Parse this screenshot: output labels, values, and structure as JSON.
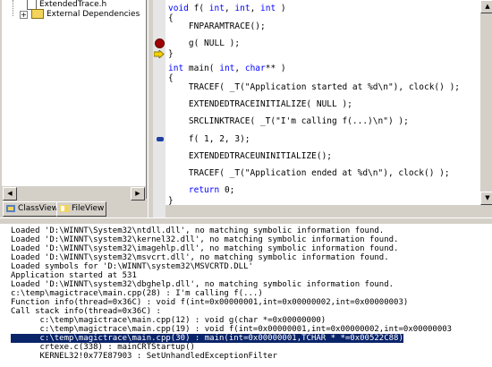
{
  "tree": {
    "items": [
      {
        "label": "ExtendedTrace.h",
        "type": "file"
      },
      {
        "label": "External Dependencies",
        "type": "folder"
      }
    ]
  },
  "tabs": [
    {
      "label": "ClassView",
      "icon": "class-view-icon",
      "active": true
    },
    {
      "label": "FileView",
      "icon": "file-view-icon",
      "active": false
    }
  ],
  "editor": {
    "lines": [
      {
        "kw": "void",
        "text": " f( ",
        "kw2": "int",
        "rest": ", ",
        "kw3": "int",
        "rest2": ", ",
        "kw4": "int",
        "rest3": " )"
      },
      {
        "text": "{"
      },
      {
        "text": "    FNPARAMTRACE();"
      },
      {
        "text": ""
      },
      {
        "text": "    g( NULL );"
      },
      {
        "text": "}"
      },
      {
        "text": ""
      },
      {
        "kw": "int",
        "text": " main( ",
        "kw2": "int",
        "rest": ", ",
        "kw3": "char",
        "rest2": "** )"
      },
      {
        "text": "{"
      },
      {
        "text": "    TRACEF( _T(\"Application started at %d\\n\"), clock() );"
      },
      {
        "text": ""
      },
      {
        "text": "    EXTENDEDTRACEINITIALIZE( NULL );"
      },
      {
        "text": ""
      },
      {
        "text": "    SRCLINKTRACE( _T(\"I'm calling f(...)\\n\") );"
      },
      {
        "text": ""
      },
      {
        "text": "    f( 1, 2, 3);"
      },
      {
        "text": ""
      },
      {
        "text": "    EXTENDEDTRACEUNINITIALIZE();"
      },
      {
        "text": ""
      },
      {
        "text": "    TRACEF( _T(\"Application ended at %d\\n\"), clock() );"
      },
      {
        "text": ""
      },
      {
        "kw_prefix": "    ",
        "kw": "return",
        "text": " 0;"
      },
      {
        "text": "}"
      }
    ]
  },
  "output": {
    "lines": [
      "Loaded 'D:\\WINNT\\System32\\ntdll.dll', no matching symbolic information found.",
      "Loaded 'D:\\WINNT\\system32\\kernel32.dll', no matching symbolic information found.",
      "Loaded 'D:\\WINNT\\system32\\imagehlp.dll', no matching symbolic information found.",
      "Loaded 'D:\\WINNT\\system32\\msvcrt.dll', no matching symbolic information found.",
      "Loaded symbols for 'D:\\WINNT\\system32\\MSVCRTD.DLL'",
      "Application started at 531",
      "Loaded 'D:\\WINNT\\system32\\dbghelp.dll', no matching symbolic information found.",
      "c:\\temp\\magictrace\\main.cpp(28) : I'm calling f(...)",
      "Function info(thread=0x36C) : void f(int=0x00000001,int=0x00000002,int=0x00000003)",
      "Call stack info(thread=0x36C) :",
      "      c:\\temp\\magictrace\\main.cpp(12) : void g(char *=0x00000000)",
      "      c:\\temp\\magictrace\\main.cpp(19) : void f(int=0x00000001,int=0x00000002,int=0x00000003",
      "      c:\\temp\\magictrace\\main.cpp(30) : main(int=0x00000001,TCHAR * *=0x00522C88)",
      "      crtexe.c(338) : mainCRTStartup()",
      "      KERNEL32!0x77E87903 : SetUnhandledExceptionFilter"
    ],
    "highlighted_index": 12
  },
  "colors": {
    "keyword": "#0000ff",
    "selection": "#0a246a",
    "breakpoint": "#a00000",
    "current_arrow": "#f2d200"
  }
}
